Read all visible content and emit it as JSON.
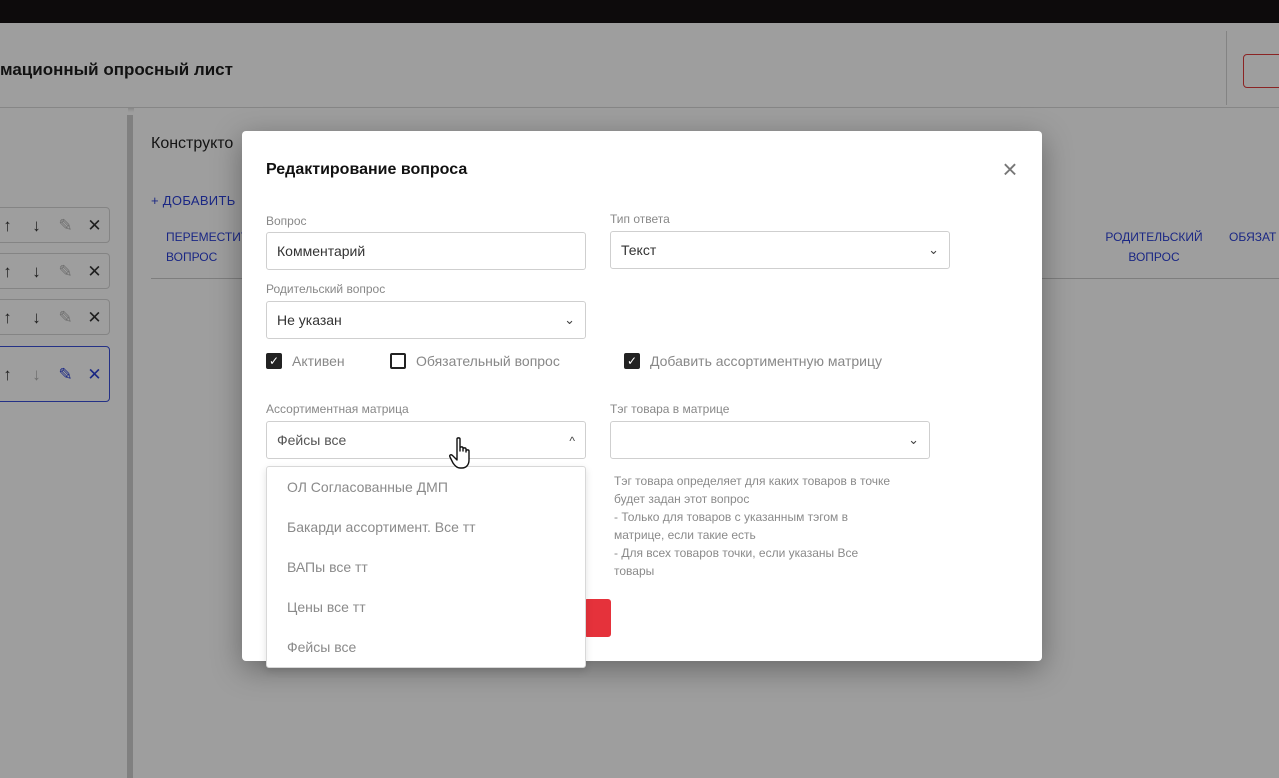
{
  "header": {
    "title": "мационный опросный лист"
  },
  "constructor": {
    "title": "Конструкто",
    "add_link": "+ ДОБАВИТЬ",
    "columns": {
      "move": [
        "ПЕРЕМЕСТИТ",
        "ВОПРОС"
      ],
      "parent": [
        "РОДИТЕЛЬСКИЙ",
        "ВОПРОС"
      ],
      "required": "ОБЯЗАТ"
    }
  },
  "row_controls": {
    "icons": [
      "arrow-up-icon",
      "arrow-down-icon",
      "pencil-icon",
      "close-icon"
    ]
  },
  "modal": {
    "title": "Редактирование вопроса",
    "question_label": "Вопрос",
    "question_value": "Комментарий",
    "answer_type_label": "Тип ответа",
    "answer_type_value": "Текст",
    "parent_label": "Родительский вопрос",
    "parent_value": "Не указан",
    "checkboxes": [
      {
        "label": "Активен",
        "checked": true
      },
      {
        "label": "Обязательный вопрос",
        "checked": false
      },
      {
        "label": "Добавить ассортиментную матрицу",
        "checked": true
      }
    ],
    "matrix_label": "Ассортиментная матрица",
    "matrix_value": "Фейсы все",
    "tag_label": "Тэг товара в матрице",
    "tag_value": "",
    "hint_lines": [
      "Тэг товара определяет для каких товаров в точке",
      "будет задан этот вопрос",
      "- Только для товаров с указанным тэгом в",
      "матрице, если такие есть",
      "- Для всех товаров точки, если указаны Все",
      "товары"
    ],
    "matrix_options": [
      "ОЛ Согласованные ДМП",
      "Бакарди ассортимент. Все тт",
      "ВАПы все тт",
      "Цены все тт",
      "Фейсы все"
    ]
  },
  "colors": {
    "accent_blue": "#2b3fd6",
    "danger_red": "#e5323b"
  }
}
